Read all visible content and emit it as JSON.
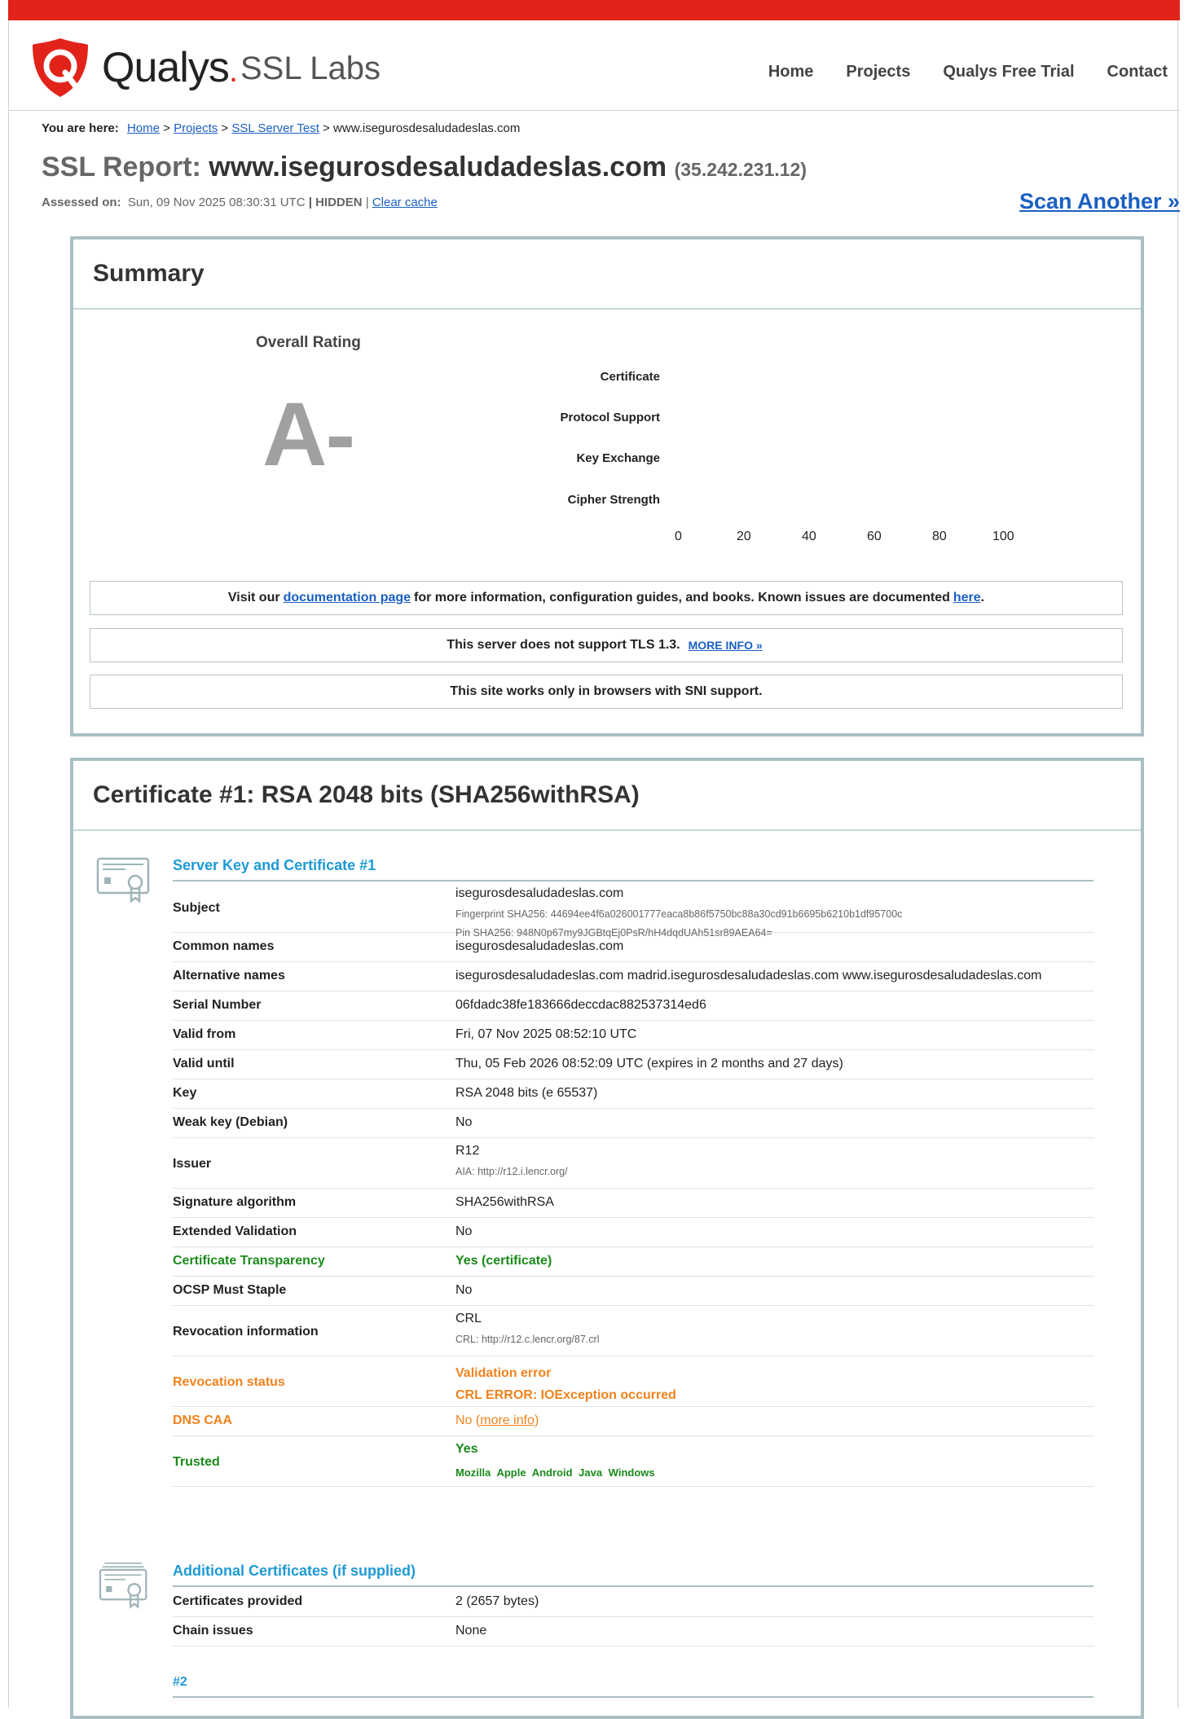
{
  "header": {
    "brand": "Qualys",
    "brand_sub": "SSL Labs",
    "nav": [
      "Home",
      "Projects",
      "Qualys Free Trial",
      "Contact"
    ]
  },
  "breadcrumb": {
    "label": "You are here:",
    "links": [
      "Home",
      "Projects",
      "SSL Server Test"
    ],
    "current": "www.isegurosdesaludadeslas.com"
  },
  "report": {
    "prefix": "SSL Report:",
    "host": "www.isegurosdesaludadeslas.com",
    "ip": "(35.242.231.12)",
    "assessed_label": "Assessed on:",
    "assessed_value": "Sun, 09 Nov 2025 08:30:31 UTC",
    "hidden": "HIDDEN",
    "clear_cache": "Clear cache",
    "scan_another": "Scan Another »"
  },
  "summary": {
    "title": "Summary",
    "overall_label": "Overall Rating",
    "grade": "A-",
    "bars": [
      "Certificate",
      "Protocol Support",
      "Key Exchange",
      "Cipher Strength"
    ],
    "axis": [
      "0",
      "20",
      "40",
      "60",
      "80",
      "100"
    ],
    "notice1": {
      "before": "Visit our",
      "link": "documentation page",
      "middle": "for more information, configuration guides, and books. Known issues are documented",
      "link2": "here",
      "after": "."
    },
    "notice2": {
      "text": "This server does not support TLS 1.3.",
      "link": "MORE INFO »"
    },
    "notice3": "This site works only in browsers with SNI support."
  },
  "certificate": {
    "title": "Certificate #1: RSA 2048 bits (SHA256withRSA)",
    "section1": "Server Key and Certificate #1",
    "subject": {
      "label": "Subject",
      "value": "isegurosdesaludadeslas.com",
      "fp": "Fingerprint SHA256: 44694ee4f6a026001777eaca8b86f5750bc88a30cd91b6695b6210b1df95700c",
      "pin": "Pin SHA256: 948N0p67my9JGBtqEj0PsR/hH4dqdUAh51sr89AEA64="
    },
    "rows": [
      {
        "label": "Common names",
        "value": "isegurosdesaludadeslas.com"
      },
      {
        "label": "Alternative names",
        "value": "isegurosdesaludadeslas.com madrid.isegurosdesaludadeslas.com www.isegurosdesaludadeslas.com"
      },
      {
        "label": "Serial Number",
        "value": "06fdadc38fe183666deccdac882537314ed6"
      },
      {
        "label": "Valid from",
        "value": "Fri, 07 Nov 2025 08:52:10 UTC"
      },
      {
        "label": "Valid until",
        "value": "Thu, 05 Feb 2026 08:52:09 UTC (expires in 2 months and 27 days)"
      },
      {
        "label": "Key",
        "value": "RSA 2048 bits (e 65537)"
      },
      {
        "label": "Weak key (Debian)",
        "value": "No"
      }
    ],
    "issuer": {
      "label": "Issuer",
      "value": "R12",
      "aia": "AIA: http://r12.i.lencr.org/"
    },
    "rows2": [
      {
        "label": "Signature algorithm",
        "value": "SHA256withRSA"
      },
      {
        "label": "Extended Validation",
        "value": "No"
      },
      {
        "label": "Certificate Transparency",
        "value": "Yes (certificate)"
      },
      {
        "label": "OCSP Must Staple",
        "value": "No"
      }
    ],
    "revocation_info": {
      "label": "Revocation information",
      "value": "CRL",
      "crl": "CRL: http://r12.c.lencr.org/87.crl"
    },
    "revocation_status": {
      "label": "Revocation status",
      "line1": "Validation error",
      "line2": "CRL ERROR: IOException occurred"
    },
    "dns_caa": {
      "label": "DNS CAA",
      "value": "No",
      "link": "more info"
    },
    "trusted": {
      "label": "Trusted",
      "value": "Yes",
      "stores": "Mozilla Apple Android Java Windows"
    },
    "section2": "Additional Certificates (if supplied)",
    "rows3": [
      {
        "label": "Certificates provided",
        "value": "2 (2657 bytes)"
      },
      {
        "label": "Chain issues",
        "value": "None"
      }
    ],
    "section3": "#2"
  }
}
